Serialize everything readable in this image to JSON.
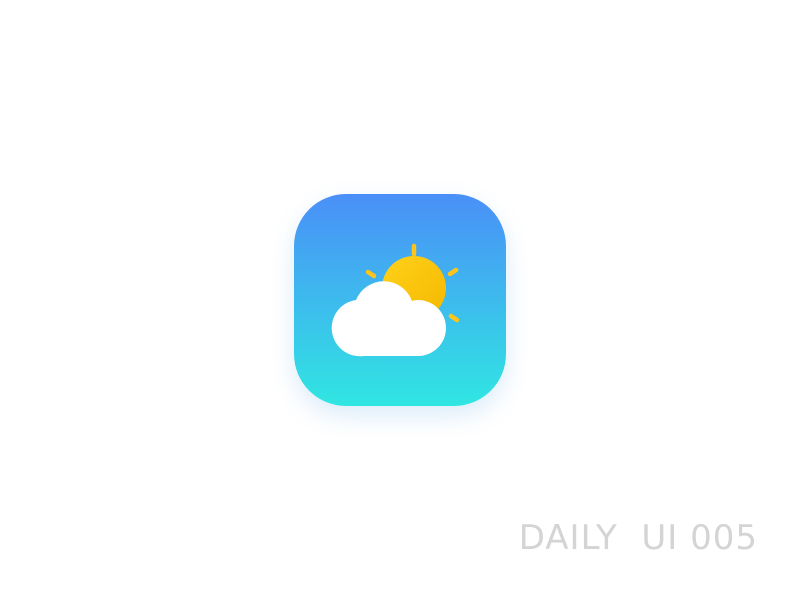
{
  "caption": {
    "text": "DAILY  UI 005"
  },
  "icon": {
    "name": "weather-partly-cloudy-icon",
    "gradient_top": "#4a8ff8",
    "gradient_bottom": "#30e6e2",
    "sun_color_light": "#ffd11a",
    "sun_color_dark": "#f5b800",
    "ray_color": "#ffc41a",
    "cloud_color": "#ffffff"
  }
}
